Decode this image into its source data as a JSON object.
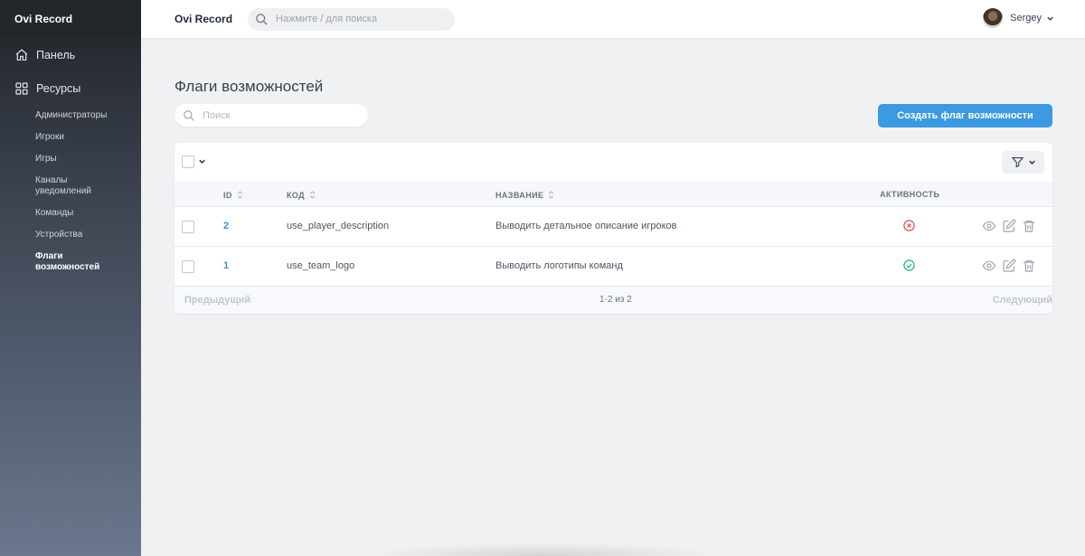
{
  "sidebar": {
    "brand": "Ovi Record",
    "main_items": [
      {
        "label": "Панель",
        "icon": "home-icon"
      },
      {
        "label": "Ресурсы",
        "icon": "grid-icon"
      }
    ],
    "sub_items": [
      {
        "label": "Администраторы"
      },
      {
        "label": "Игроки"
      },
      {
        "label": "Игры"
      },
      {
        "label": "Каналы уведомлений"
      },
      {
        "label": "Команды"
      },
      {
        "label": "Устройства"
      },
      {
        "label": "Флаги возможностей",
        "active": true
      }
    ]
  },
  "header": {
    "brand": "Ovi Record",
    "search_placeholder": "Нажмите / для поиска",
    "user_name": "Sergey"
  },
  "main": {
    "title": "Флаги возможностей",
    "search_placeholder": "Поиск",
    "create_button": "Создать флаг возможности",
    "columns": [
      "ID",
      "КОД",
      "НАЗВАНИЕ",
      "АКТИВНОСТЬ"
    ],
    "rows": [
      {
        "id": "2",
        "code": "use_player_description",
        "title": "Выводить детальное описание игроков",
        "active": false
      },
      {
        "id": "1",
        "code": "use_team_logo",
        "title": "Выводить логотипы команд",
        "active": true
      }
    ],
    "pagination": {
      "prev": "Предыдущий",
      "info": "1-2 из 2",
      "next": "Следующий"
    }
  },
  "colors": {
    "accent": "#3b9ae1",
    "inactive": "#e05252",
    "active": "#2bb673"
  }
}
